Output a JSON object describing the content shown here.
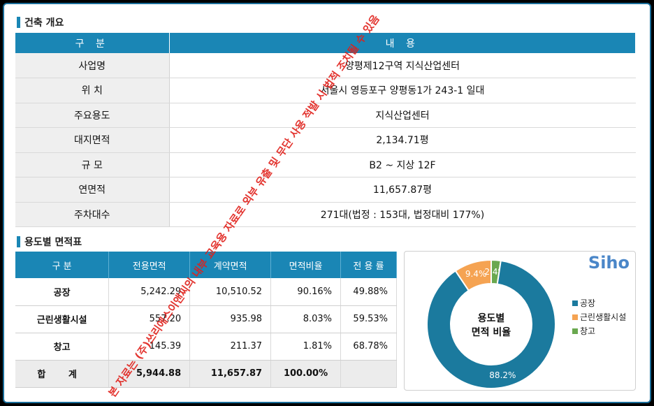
{
  "overview": {
    "title": "건축 개요",
    "headers": [
      "구 분",
      "내 용"
    ],
    "rows": [
      {
        "label": "사업명",
        "value": "양평제12구역 지식산업센터"
      },
      {
        "label": "위 치",
        "value": "서울시 영등포구 양평동1가 243-1 일대"
      },
      {
        "label": "주요용도",
        "value": "지식산업센터"
      },
      {
        "label": "대지면적",
        "value": "2,134.71평"
      },
      {
        "label": "규 모",
        "value": "B2 ~ 지상 12F"
      },
      {
        "label": "연면적",
        "value": "11,657.87평"
      },
      {
        "label": "주차대수",
        "value": "271대(법정 : 153대, 법정대비 177%)"
      }
    ]
  },
  "area_table": {
    "title": "용도별 면적표",
    "headers": [
      "구 분",
      "전용면적",
      "계약면적",
      "면적비율",
      "전 용 률"
    ],
    "rows": [
      [
        "공장",
        "5,242.29",
        "10,510.52",
        "90.16%",
        "49.88%"
      ],
      [
        "근린생활시설",
        "557.20",
        "935.98",
        "8.03%",
        "59.53%"
      ],
      [
        "창고",
        "145.39",
        "211.37",
        "1.81%",
        "68.78%"
      ]
    ],
    "total": [
      "합 계",
      "5,944.88",
      "11,657.87",
      "100.00%",
      ""
    ]
  },
  "chart_data": {
    "type": "pie",
    "center_label": "용도별\n면적 비율",
    "categories": [
      "공장",
      "근린생활시설",
      "창고"
    ],
    "values": [
      88.2,
      9.4,
      2.4
    ],
    "data_labels": [
      "88.2%",
      "9.4%",
      "2.4%"
    ],
    "colors": [
      "#1b7a9e",
      "#f5a352",
      "#6aa84f"
    ],
    "legend_placement": "right"
  },
  "brand": "Siho",
  "watermark": "본 자료는 (주)쓰리에스이앤씨의 내부 교육용 자료로 외부 유출 및 무단 사용 적발 시 법적 조치될 수 있음"
}
